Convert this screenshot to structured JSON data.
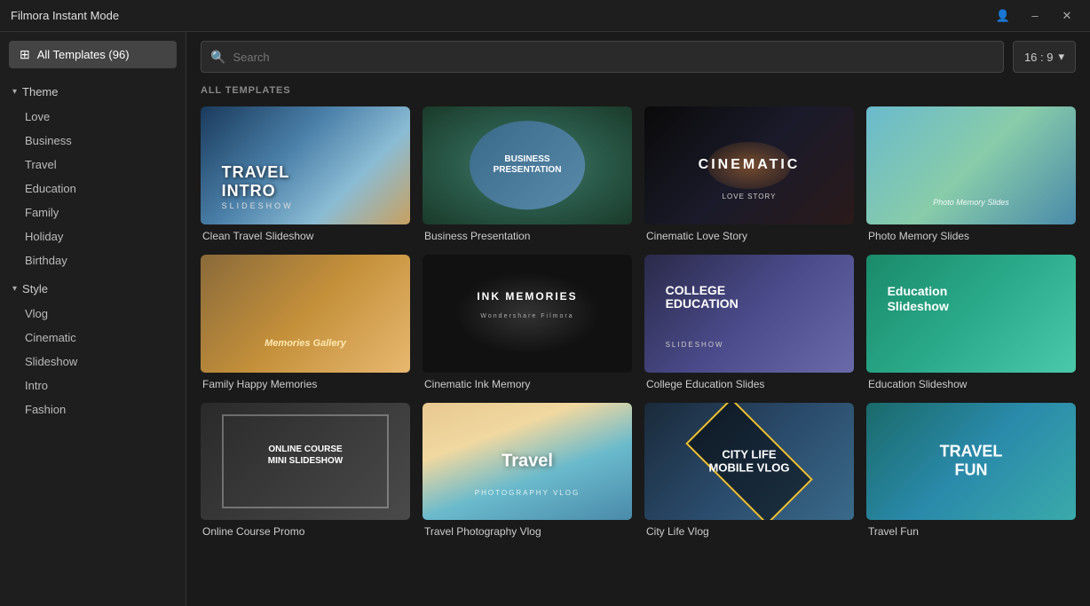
{
  "titlebar": {
    "title": "Filmora Instant Mode",
    "minimize_label": "–",
    "close_label": "✕",
    "user_icon": "👤"
  },
  "sidebar": {
    "all_templates_label": "All Templates (96)",
    "all_templates_icon": "⊞",
    "categories": [
      {
        "label": "Theme",
        "expanded": true,
        "items": [
          "Love",
          "Business",
          "Travel",
          "Education",
          "Family",
          "Holiday",
          "Birthday"
        ]
      },
      {
        "label": "Style",
        "expanded": true,
        "items": [
          "Vlog",
          "Cinematic",
          "Slideshow",
          "Intro",
          "Fashion"
        ]
      }
    ]
  },
  "topbar": {
    "search_placeholder": "Search",
    "aspect_ratio": "16 : 9",
    "aspect_arrow": "▾"
  },
  "content": {
    "section_label": "ALL TEMPLATES",
    "templates": [
      {
        "id": "clean-travel",
        "name": "Clean Travel Slideshow",
        "thumb_type": "travel",
        "thumb_text": "TRAVEL\nINTRO",
        "thumb_sub": "SLIDESHOW"
      },
      {
        "id": "business-presentation",
        "name": "Business Presentation",
        "thumb_type": "business",
        "thumb_text": "BUSINESS\nPRESENTATION",
        "thumb_sub": ""
      },
      {
        "id": "cinematic-love",
        "name": "Cinematic Love Story",
        "thumb_type": "cinematic",
        "thumb_text": "CINEMATIC",
        "thumb_sub": "LOVE STORY"
      },
      {
        "id": "photo-memory",
        "name": "Photo Memory Slides",
        "thumb_type": "photo-memory",
        "thumb_text": "Photo Memory Slides",
        "thumb_sub": ""
      },
      {
        "id": "family-happy",
        "name": "Family Happy Memories",
        "thumb_type": "family",
        "thumb_text": "Memories Gallery",
        "thumb_sub": ""
      },
      {
        "id": "cinematic-ink",
        "name": "Cinematic Ink Memory",
        "thumb_type": "ink",
        "thumb_text": "INK MEMORIES",
        "thumb_sub": "Wondershare Filmora"
      },
      {
        "id": "college-education",
        "name": "College Education Slides",
        "thumb_type": "college",
        "thumb_text": "COLLEGE\nEDUCATION",
        "thumb_sub": "SLIDESHOW"
      },
      {
        "id": "education-slideshow",
        "name": "Education Slideshow",
        "thumb_type": "edu-slideshow",
        "thumb_text": "Education\nSlideshow",
        "thumb_sub": ""
      },
      {
        "id": "online-course",
        "name": "Online Course Promo",
        "thumb_type": "online-course",
        "thumb_text": "ONLINE COURSE\nMINI SLIDESHOW",
        "thumb_sub": ""
      },
      {
        "id": "travel-photo",
        "name": "Travel Photography Vlog",
        "thumb_type": "travel-photo",
        "thumb_text": "Travel",
        "thumb_sub": "PHOTOGRAPHY VLOG"
      },
      {
        "id": "city-life",
        "name": "City Life Vlog",
        "thumb_type": "city",
        "thumb_text": "CITY LIFE\nMOBILE VLOG",
        "thumb_sub": ""
      },
      {
        "id": "travel-fun",
        "name": "Travel Fun",
        "thumb_type": "travel-fun",
        "thumb_text": "TRAVEL\nFUN",
        "thumb_sub": ""
      }
    ]
  }
}
